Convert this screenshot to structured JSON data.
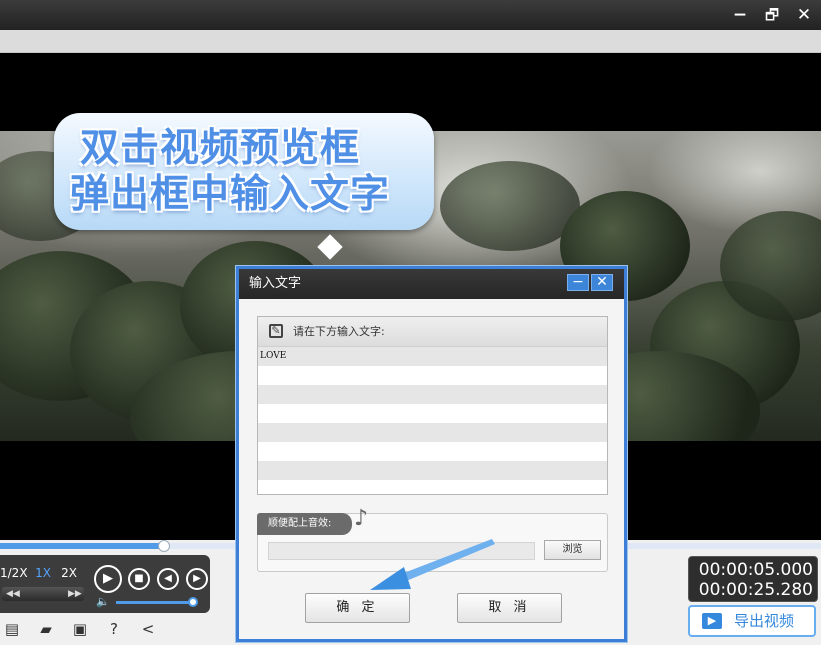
{
  "window": {
    "controls": {
      "minimize": "−",
      "restore": "🗗",
      "close": "✕"
    }
  },
  "video": {
    "caption": {
      "line1": "双击视频预览框",
      "line2": "弹出框中输入文字"
    }
  },
  "player": {
    "progress_fraction": 0.2,
    "speeds": [
      {
        "label": "1/2X",
        "selected": false
      },
      {
        "label": "1X",
        "selected": true
      },
      {
        "label": "2X",
        "selected": false
      }
    ],
    "buttons": {
      "play": "▶",
      "stop": "■",
      "prev": "◀",
      "next": "▶"
    },
    "volume_fraction": 1.0,
    "current_time": "00:00:05.000",
    "total_time": "00:00:25.280"
  },
  "toolbar": {
    "export_label": "导出视频",
    "icons": [
      "new-file-icon",
      "open-folder-icon",
      "save-icon",
      "help-icon",
      "share-icon"
    ]
  },
  "dialog": {
    "title": "输入文字",
    "min_label": "−",
    "close_label": "✕",
    "text_header": "请在下方输入文字:",
    "text_value": "LOVE",
    "music_label": "顺便配上音效:",
    "browse_label": "浏览",
    "ok_label": "确 定",
    "cancel_label": "取 消"
  },
  "colors": {
    "accent": "#3d7fd6",
    "caption_text": "#4f8fe6",
    "timecode_bg": "#2e2e2e",
    "pointer_arrow": "#3b8fe0"
  }
}
